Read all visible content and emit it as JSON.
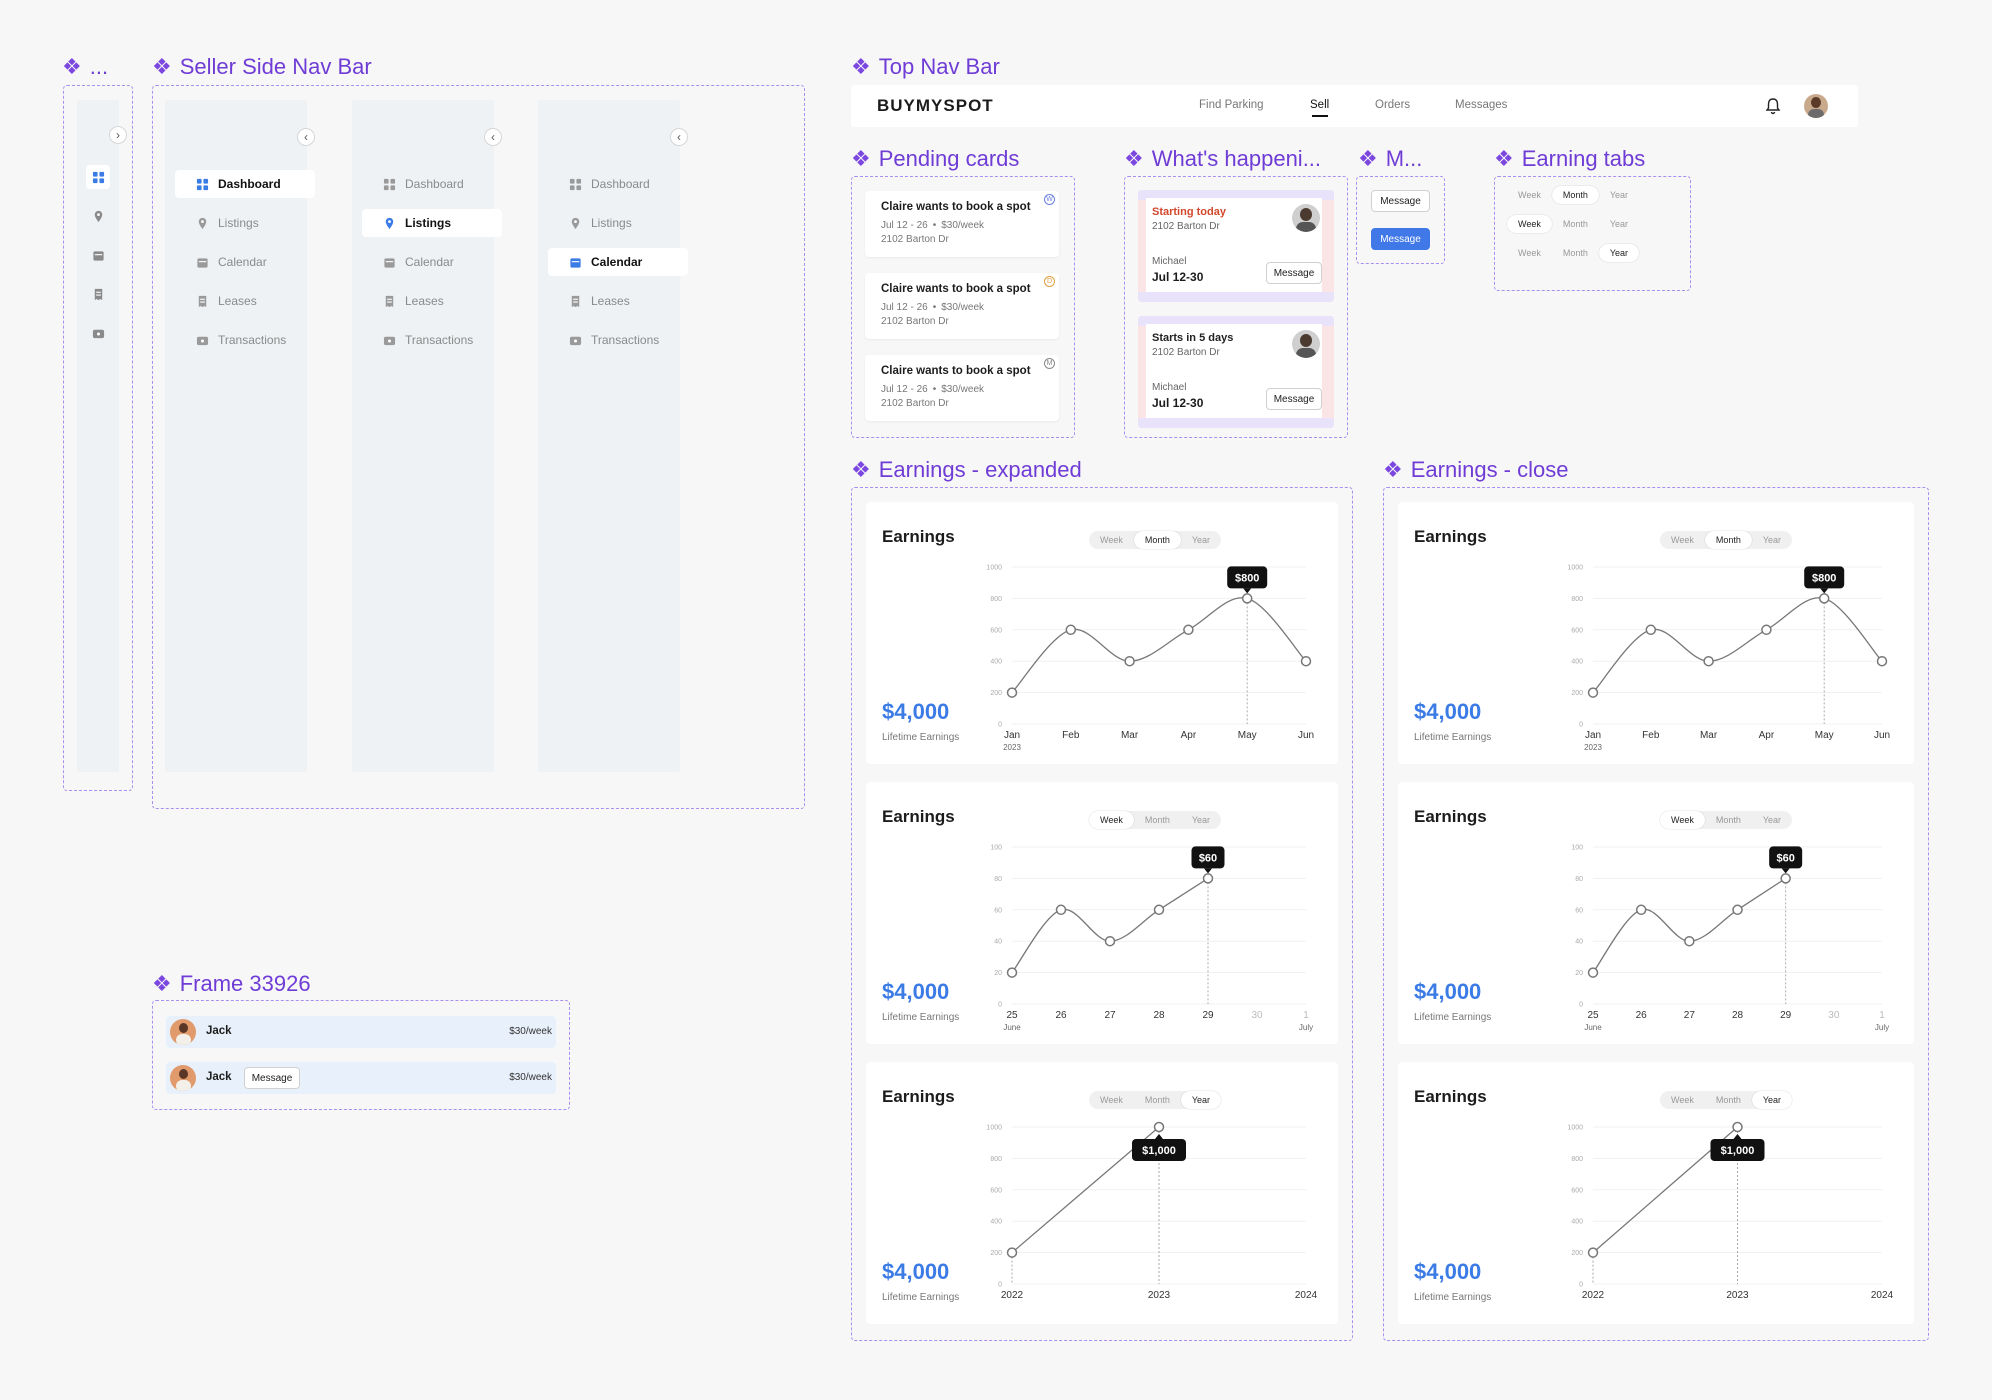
{
  "frames": {
    "collapsed_nav": "...",
    "seller_nav": "Seller Side Nav Bar",
    "top_nav": "Top Nav Bar",
    "pending": "Pending cards",
    "happening": "What's happeni...",
    "message": "M...",
    "earning_tabs": "Earning tabs",
    "earn_expanded": "Earnings - expanded",
    "earn_close": "Earnings - close",
    "frame_33926": "Frame 33926"
  },
  "side_nav": {
    "items": [
      "Dashboard",
      "Listings",
      "Calendar",
      "Leases",
      "Transactions"
    ],
    "icons": [
      "dashboard-icon",
      "pin-icon",
      "calendar-icon",
      "receipt-icon",
      "wallet-icon"
    ],
    "accent": "#3b7be6"
  },
  "top_nav": {
    "logo": "BUYMYSPOT",
    "links": [
      "Find Parking",
      "Sell",
      "Orders",
      "Messages"
    ],
    "active": "Sell"
  },
  "pending_cards": [
    {
      "title": "Claire wants to book a spot",
      "dates": "Jul 12 - 26",
      "sep": "•",
      "price": "$30/week",
      "address": "2102 Barton Dr",
      "badge": "W"
    },
    {
      "title": "Claire wants to book a spot",
      "dates": "Jul 12 - 26",
      "sep": "•",
      "price": "$30/week",
      "address": "2102 Barton Dr",
      "badge": "D"
    },
    {
      "title": "Claire wants to book a spot",
      "dates": "Jul 12 - 26",
      "sep": "•",
      "price": "$30/week",
      "address": "2102 Barton Dr",
      "badge": "M"
    }
  ],
  "happening": [
    {
      "status": "Starting today",
      "address": "2102 Barton Dr",
      "name": "Michael",
      "dates": "Jul 12-30",
      "button": "Message"
    },
    {
      "status": "Starts in 5 days",
      "address": "2102 Barton Dr",
      "name": "Michael",
      "dates": "Jul 12-30",
      "button": "Message"
    }
  ],
  "message_buttons": [
    "Message",
    "Message"
  ],
  "tabs": [
    "Week",
    "Month",
    "Year"
  ],
  "earnings": {
    "title": "Earnings",
    "amount": "$4,000",
    "amount_label": "Lifetime Earnings"
  },
  "frame_33926": [
    {
      "name": "Jack",
      "price": "$30/week",
      "button": ""
    },
    {
      "name": "Jack",
      "price": "$30/week",
      "button": "Message"
    }
  ],
  "chart_data": [
    {
      "type": "line",
      "title": "Earnings",
      "tab": "Month",
      "categories": [
        "Jan",
        "Feb",
        "Mar",
        "Apr",
        "May",
        "Jun"
      ],
      "sublabels": {
        "0": "2023"
      },
      "values": [
        200,
        600,
        400,
        600,
        800,
        400
      ],
      "ylim": [
        0,
        1000
      ],
      "yticks": [
        0,
        200,
        400,
        600,
        800,
        1000
      ],
      "highlight_index": 4,
      "highlight_label": "$800"
    },
    {
      "type": "line",
      "title": "Earnings",
      "tab": "Week",
      "categories": [
        "25",
        "26",
        "27",
        "28",
        "29",
        "30",
        "1"
      ],
      "sublabels": {
        "0": "June",
        "6": "July"
      },
      "values": [
        20,
        60,
        40,
        60,
        80,
        null,
        null
      ],
      "ylim": [
        0,
        100
      ],
      "yticks": [
        0,
        20,
        40,
        60,
        80,
        100
      ],
      "highlight_index": 4,
      "highlight_label": "$60"
    },
    {
      "type": "line",
      "title": "Earnings",
      "tab": "Year",
      "categories": [
        "2022",
        "2023",
        "2024"
      ],
      "sublabels": {},
      "values": [
        200,
        1000,
        null
      ],
      "ylim": [
        0,
        1000
      ],
      "yticks": [
        0,
        200,
        400,
        600,
        800,
        1000
      ],
      "highlight_index": 1,
      "highlight_label": "$1,000"
    }
  ]
}
